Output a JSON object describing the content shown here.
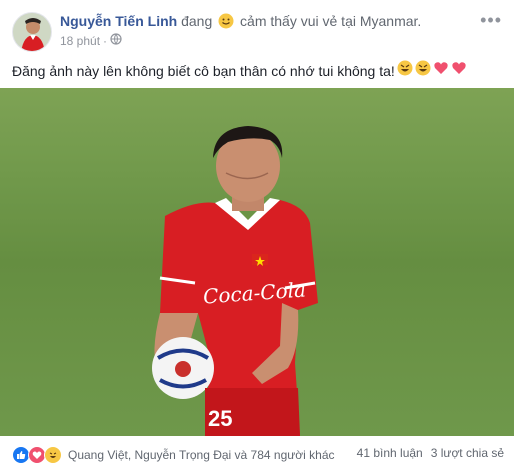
{
  "post": {
    "author": "Nguyễn Tiến Linh",
    "feeling_prefix": "đang",
    "feeling_text": "cảm thấy vui vẻ tại Myanmar.",
    "time": "18 phút",
    "privacy_icon": "globe-icon",
    "more_label": "•••",
    "caption": "Đăng ảnh này lên không biết cô bạn thân có nhớ tui không ta!",
    "caption_emojis": [
      "rofl",
      "rofl",
      "heart",
      "heart"
    ]
  },
  "photo": {
    "jersey_text": "Coca-Cola",
    "jersey_number": "25"
  },
  "footer": {
    "reaction_icons": [
      "like-icon",
      "love-icon",
      "haha-icon"
    ],
    "reaction_names": "Quang Việt, Nguyễn Trọng Đại và 784 người khác",
    "comments": "41 bình luận",
    "shares": "3 lượt chia sẻ"
  },
  "colors": {
    "name": "#385898",
    "jersey": "#d81e23",
    "grass": "#5f8a3a"
  }
}
